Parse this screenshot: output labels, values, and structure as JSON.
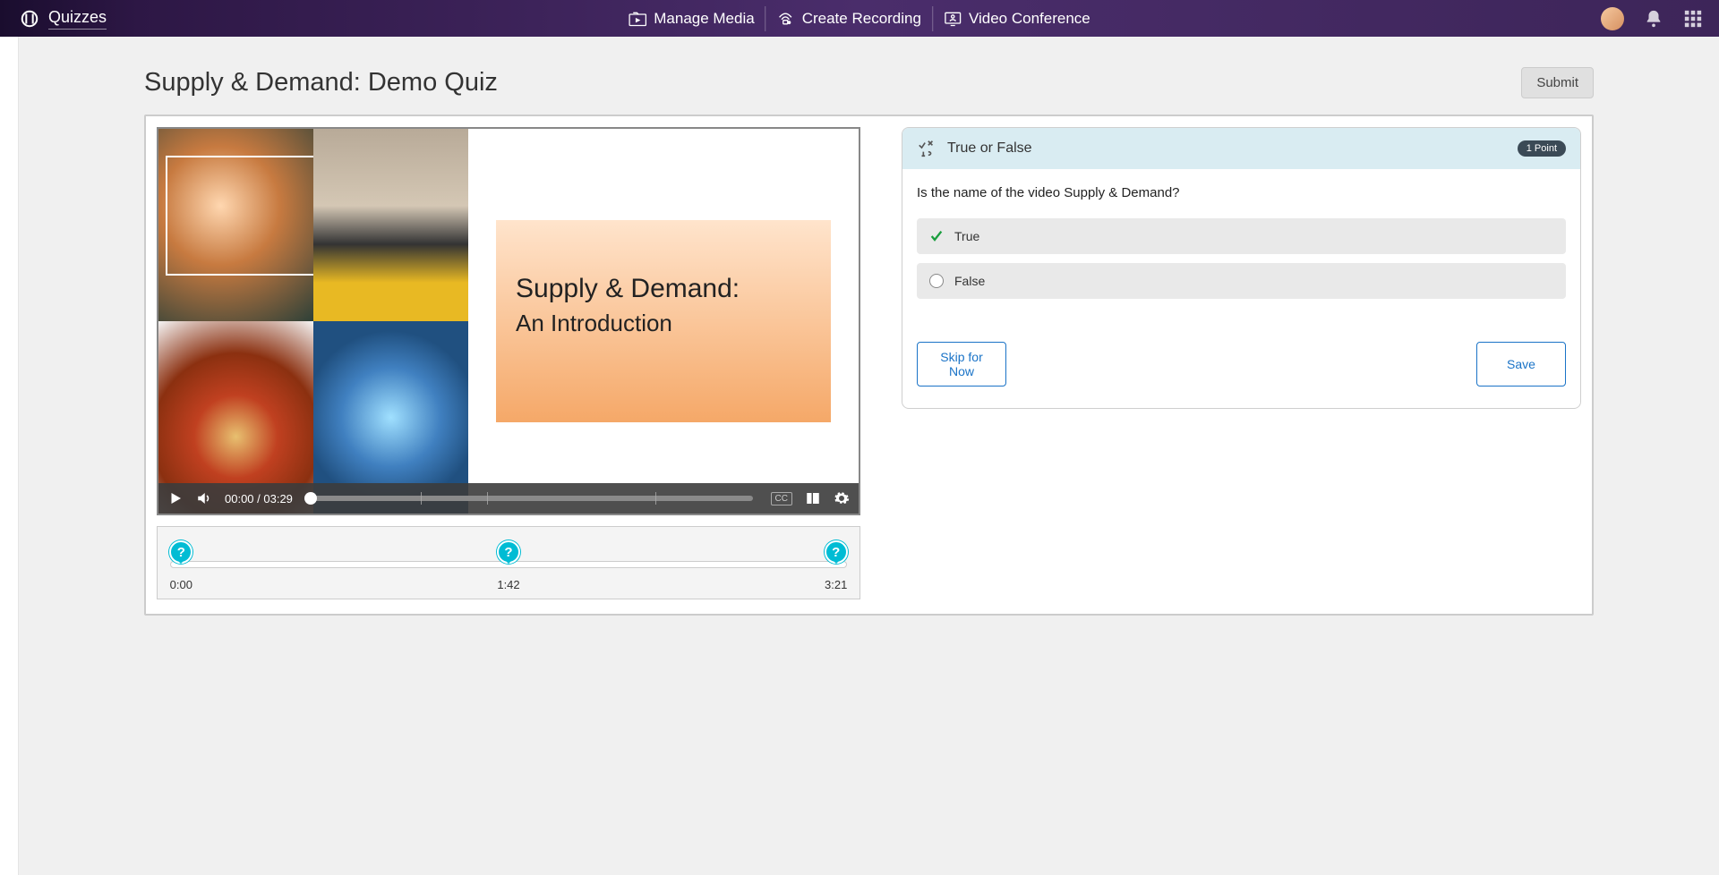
{
  "topbar": {
    "page_label": "Quizzes",
    "nav": {
      "manage_media": "Manage Media",
      "create_recording": "Create Recording",
      "video_conference": "Video Conference"
    }
  },
  "quiz": {
    "title": "Supply & Demand: Demo Quiz",
    "submit_label": "Submit"
  },
  "video": {
    "slide_title": "Supply & Demand:",
    "slide_subtitle": "An Introduction",
    "time_display": "00:00 / 03:29",
    "cc_label": "CC"
  },
  "timeline": {
    "markers": [
      {
        "percent": 1.5,
        "time": "0:00"
      },
      {
        "percent": 50,
        "time": "1:42"
      },
      {
        "percent": 98.5,
        "time": "3:21"
      }
    ]
  },
  "question": {
    "type_label": "True or False",
    "points_label": "1 Point",
    "text": "Is the name of the video Supply & Demand?",
    "answers": {
      "true_label": "True",
      "false_label": "False"
    },
    "skip_label": "Skip for Now",
    "save_label": "Save"
  }
}
